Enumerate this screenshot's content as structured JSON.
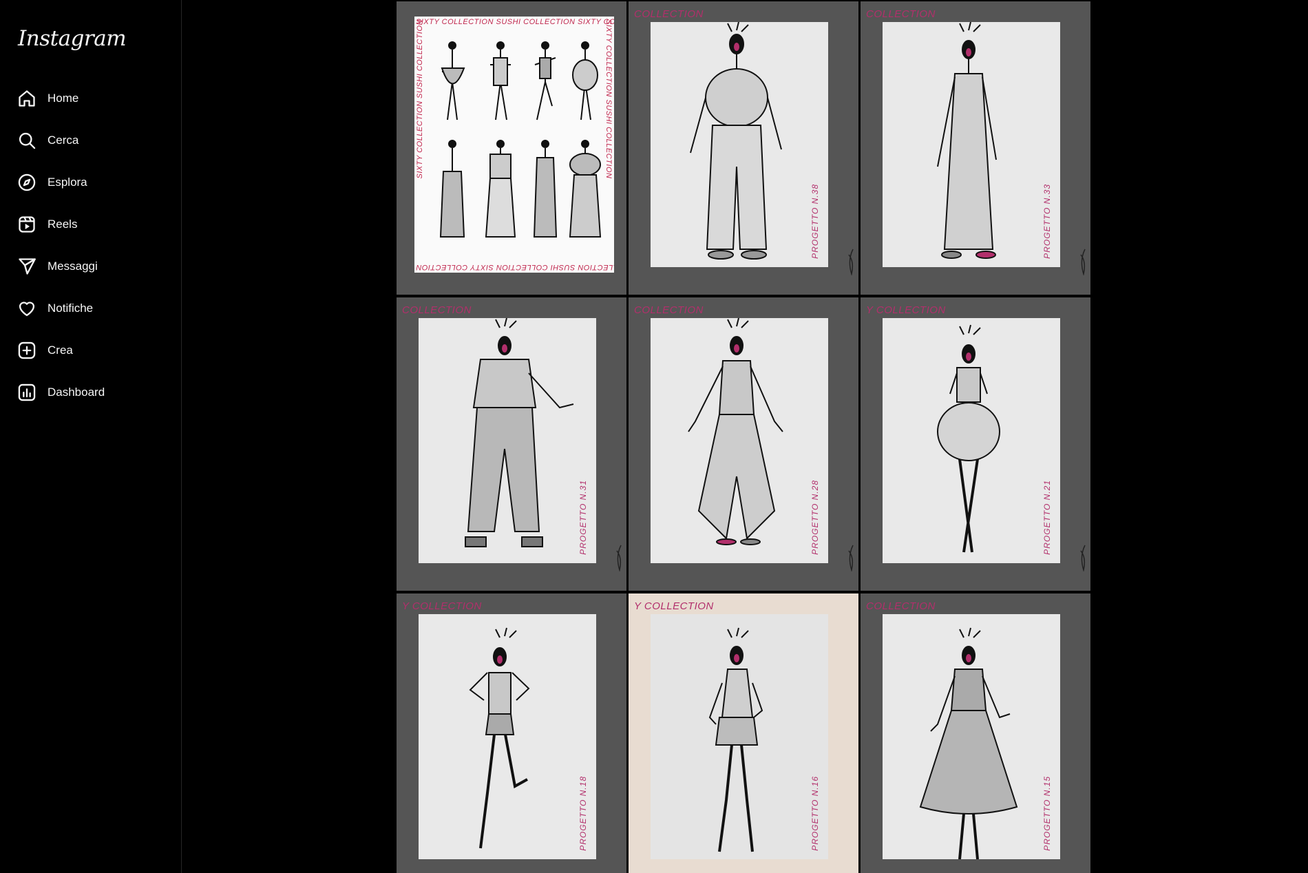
{
  "app": {
    "logo": "Instagram"
  },
  "sidebar": {
    "items": [
      {
        "label": "Home",
        "icon": "home-icon"
      },
      {
        "label": "Cerca",
        "icon": "search-icon"
      },
      {
        "label": "Esplora",
        "icon": "compass-icon"
      },
      {
        "label": "Reels",
        "icon": "reels-icon"
      },
      {
        "label": "Messaggi",
        "icon": "send-icon"
      },
      {
        "label": "Notifiche",
        "icon": "heart-icon"
      },
      {
        "label": "Crea",
        "icon": "plus-square-icon"
      },
      {
        "label": "Dashboard",
        "icon": "dashboard-icon"
      }
    ]
  },
  "grid": {
    "first_sheet": {
      "border_text": "SIXTY COLLECTION SUSHI COLLECTION SIXTY COLLECTION",
      "side_text": "SIXTY COLLECTION SUSHI COLLECTION"
    },
    "posts": [
      {
        "header": "COLLECTION",
        "project": "PROGETTO N.38"
      },
      {
        "header": "COLLECTION",
        "project": "PROGETTO N.33"
      },
      {
        "header": "COLLECTION",
        "project": "PROGETTO N.31"
      },
      {
        "header": "COLLECTION",
        "project": "PROGETTO N.28"
      },
      {
        "header": "Y COLLECTION",
        "project": "PROGETTO N.21"
      },
      {
        "header": "Y COLLECTION",
        "project": "PROGETTO N.18"
      },
      {
        "header": "Y COLLECTION",
        "project": "PROGETTO N.16"
      },
      {
        "header": "COLLECTION",
        "project": "PROGETTO N.15"
      }
    ]
  },
  "colors": {
    "accent": "#b22f6b",
    "tile_bg": "#555555",
    "card_bg": "#e9e9e9"
  }
}
